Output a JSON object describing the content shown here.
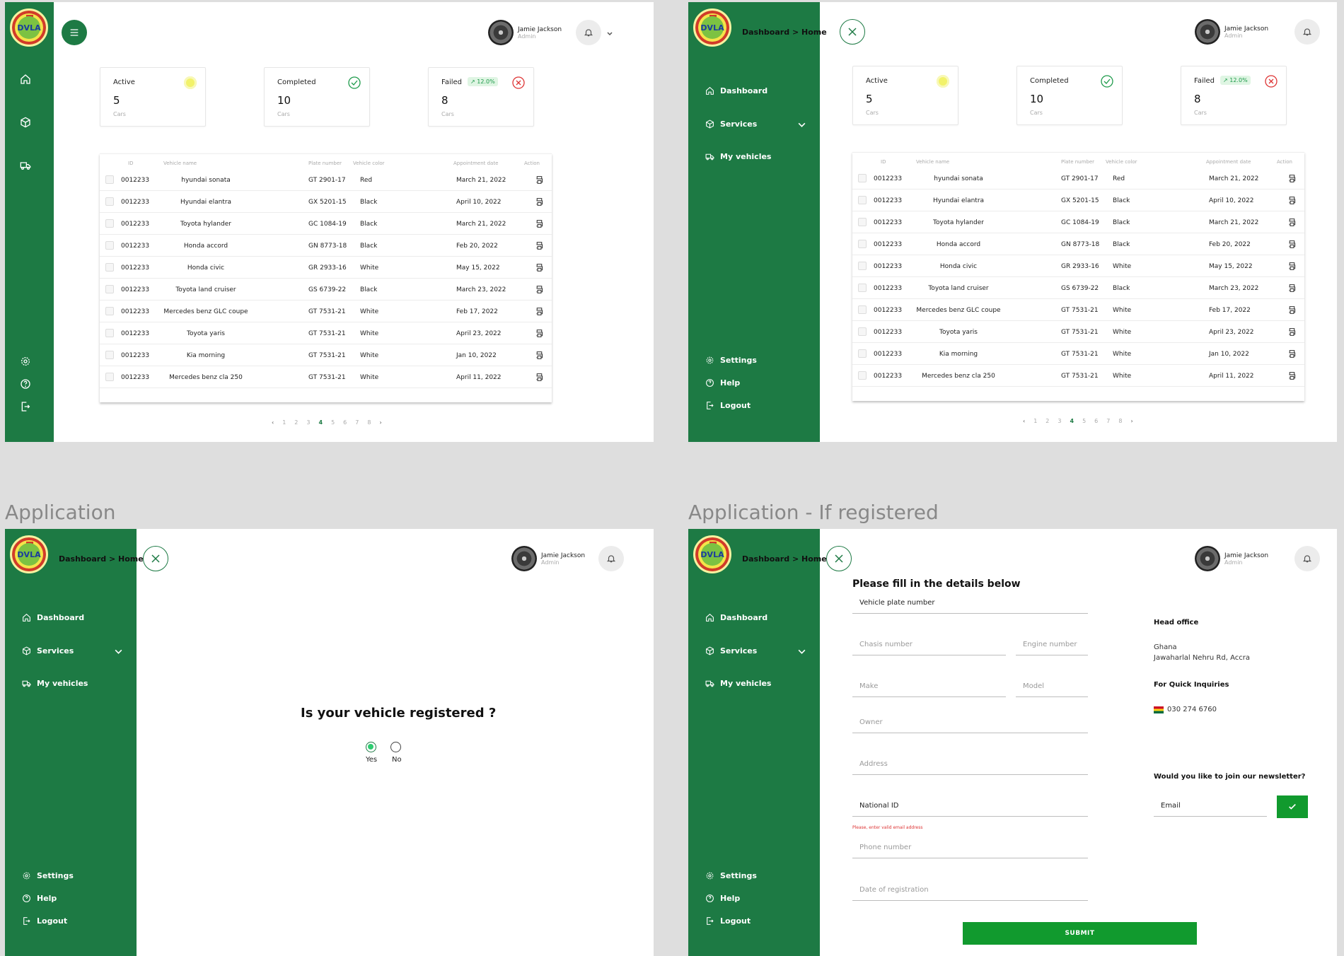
{
  "brand": {
    "logo_text": "DVLA",
    "primary_color": "#1d7a44",
    "accent_color": "#119a2e"
  },
  "breadcrumb": {
    "parent": "Dashboard",
    "separator": ">",
    "current": "Home"
  },
  "user": {
    "name": "Jamie Jackson",
    "role": "Admin"
  },
  "nav": {
    "dashboard": "Dashboard",
    "services": "Services",
    "my_vehicles": "My vehicles",
    "settings": "Settings",
    "help": "Help",
    "logout": "Logout"
  },
  "stats": {
    "active": {
      "label": "Active",
      "value": "5",
      "unit": "Cars",
      "color": "#f2f26a"
    },
    "completed": {
      "label": "Completed",
      "value": "10",
      "unit": "Cars",
      "color": "#1d9a4a"
    },
    "failed": {
      "label": "Failed",
      "value": "8",
      "unit": "Cars",
      "badge": "12.0%",
      "color": "#d33"
    }
  },
  "table": {
    "headers": {
      "id": "ID",
      "vehicle_name": "Vehicle name",
      "plate": "Plate number",
      "color": "Vehicle color",
      "date": "Appointment date",
      "action": "Action"
    },
    "rows": [
      {
        "id": "0012233",
        "name": "hyundai sonata",
        "plate": "GT 2901-17",
        "color": "Red",
        "date": "March 21, 2022"
      },
      {
        "id": "0012233",
        "name": "Hyundai elantra",
        "plate": "GX 5201-15",
        "color": "Black",
        "date": "April 10, 2022"
      },
      {
        "id": "0012233",
        "name": "Toyota hylander",
        "plate": "GC 1084-19",
        "color": "Black",
        "date": "March 21, 2022"
      },
      {
        "id": "0012233",
        "name": "Honda accord",
        "plate": "GN 8773-18",
        "color": "Black",
        "date": "Feb 20, 2022"
      },
      {
        "id": "0012233",
        "name": "Honda civic",
        "plate": "GR 2933-16",
        "color": "White",
        "date": "May 15, 2022"
      },
      {
        "id": "0012233",
        "name": "Toyota land cruiser",
        "plate": "GS 6739-22",
        "color": "Black",
        "date": "March 23, 2022"
      },
      {
        "id": "0012233",
        "name": "Mercedes benz GLC coupe",
        "plate": "GT 7531-21",
        "color": "White",
        "date": "Feb 17, 2022"
      },
      {
        "id": "0012233",
        "name": "Toyota yaris",
        "plate": "GT 7531-21",
        "color": "White",
        "date": "April 23, 2022"
      },
      {
        "id": "0012233",
        "name": "Kia morning",
        "plate": "GT 7531-21",
        "color": "White",
        "date": "Jan 10, 2022"
      },
      {
        "id": "0012233",
        "name": "Mercedes benz cla 250",
        "plate": "GT 7531-21",
        "color": "White",
        "date": "April 11, 2022"
      }
    ]
  },
  "pagination": {
    "pages": [
      "1",
      "2",
      "3",
      "4",
      "5",
      "6",
      "7",
      "8"
    ],
    "current": "4"
  },
  "sections": {
    "application": "Application",
    "application_registered": "Application - If registered"
  },
  "registration_question": {
    "question": "Is your vehicle registered ?",
    "yes": "Yes",
    "no": "No",
    "selected": "Yes"
  },
  "form": {
    "title": "Please fill in the details below",
    "plate": "Vehicle plate number",
    "chassis": "Chasis number",
    "engine": "Engine number",
    "make": "Make",
    "model": "Model",
    "owner": "Owner",
    "address": "Address",
    "national_id": "National ID",
    "error": "Please, enter valid email address",
    "phone": "Phone number",
    "date_reg": "Date of registration",
    "submit": "SUBMIT"
  },
  "info": {
    "head_office_label": "Head office",
    "country": "Ghana",
    "address": "Jawaharlal Nehru Rd, Accra",
    "quick_label": "For Quick Inquiries",
    "phone": "030 274 6760",
    "newsletter_label": "Would you like to join our newsletter?",
    "email_placeholder": "Email"
  }
}
